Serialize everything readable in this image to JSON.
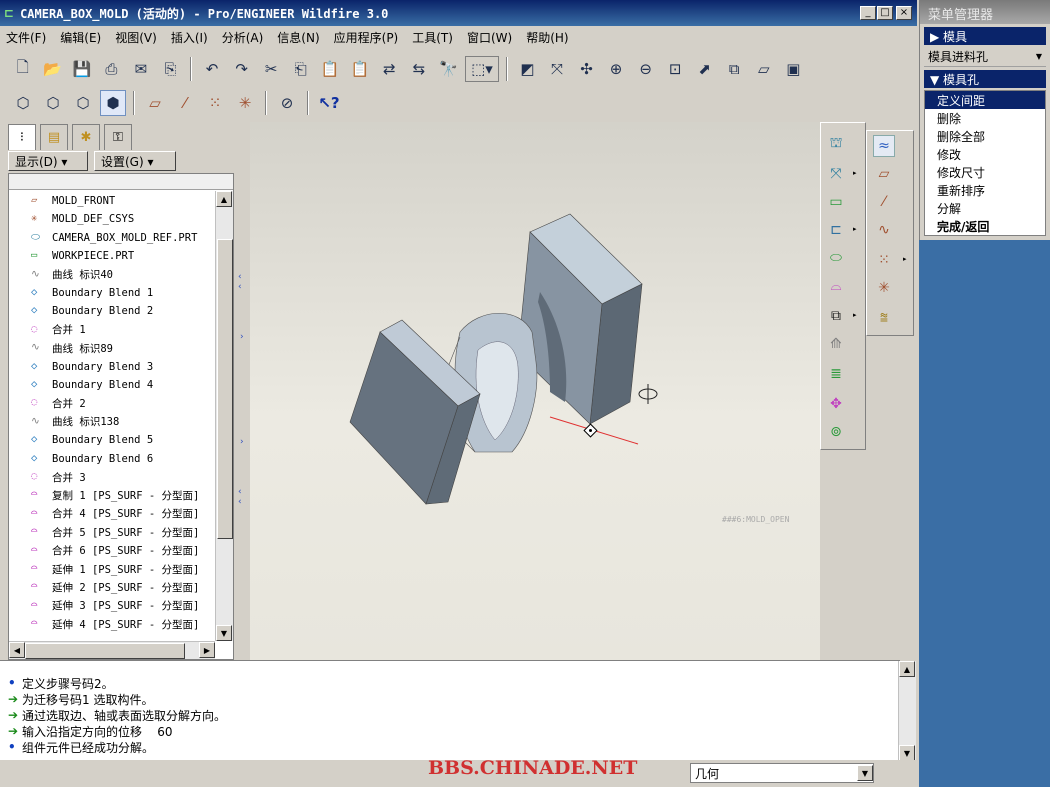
{
  "window": {
    "title": "CAMERA_BOX_MOLD (活动的) - Pro/ENGINEER Wildfire 3.0",
    "minimize": "_",
    "maximize": "□",
    "close": "×"
  },
  "menubar": [
    "文件(F)",
    "编辑(E)",
    "视图(V)",
    "插入(I)",
    "分析(A)",
    "信息(N)",
    "应用程序(P)",
    "工具(T)",
    "窗口(W)",
    "帮助(H)"
  ],
  "left_panel": {
    "display_label": "显示(D) ▾",
    "settings_label": "设置(G) ▾",
    "tree": [
      "MOLD_FRONT",
      "MOLD_DEF_CSYS",
      "CAMERA_BOX_MOLD_REF.PRT",
      "WORKPIECE.PRT",
      "曲线 标识40",
      "Boundary Blend 1",
      "Boundary Blend 2",
      "合并 1",
      "曲线 标识89",
      "Boundary Blend 3",
      "Boundary Blend 4",
      "合并 2",
      "曲线 标识138",
      "Boundary Blend 5",
      "Boundary Blend 6",
      "合并 3",
      "复制 1 [PS_SURF - 分型面]",
      "合并 4 [PS_SURF - 分型面]",
      "合并 5 [PS_SURF - 分型面]",
      "合并 6 [PS_SURF - 分型面]",
      "延伸 1 [PS_SURF - 分型面]",
      "延伸 2 [PS_SURF - 分型面]",
      "延伸 3 [PS_SURF - 分型面]",
      "延伸 4 [PS_SURF - 分型面]"
    ]
  },
  "graphics": {
    "annotation": "###6:MOLD_OPEN"
  },
  "menu_manager": {
    "title": "菜单管理器",
    "header1": "▶ 模具",
    "dropdown": "模具进料孔",
    "header2": "▼ 模具孔",
    "items": [
      "定义间距",
      "删除",
      "删除全部",
      "修改",
      "修改尺寸",
      "重新排序",
      "分解",
      "完成/返回"
    ]
  },
  "messages": [
    {
      "icon": "bullet",
      "text": "定义步骤号码2。"
    },
    {
      "icon": "arrow",
      "text": "为迁移号码1 选取构件。"
    },
    {
      "icon": "arrow",
      "text": "通过选取边、轴或表面选取分解方向。"
    },
    {
      "icon": "arrow",
      "text": "输入沿指定方向的位移    60"
    },
    {
      "icon": "bullet",
      "text": "组件元件已经成功分解。"
    }
  ],
  "status": {
    "watermark": "BBS.CHINADE.NET",
    "filter": "几何"
  },
  "colors": {
    "title_bar": "#0a246a",
    "model": "#5e6a78",
    "watermark": "#d03030",
    "desktop": "#3a6ea5"
  }
}
